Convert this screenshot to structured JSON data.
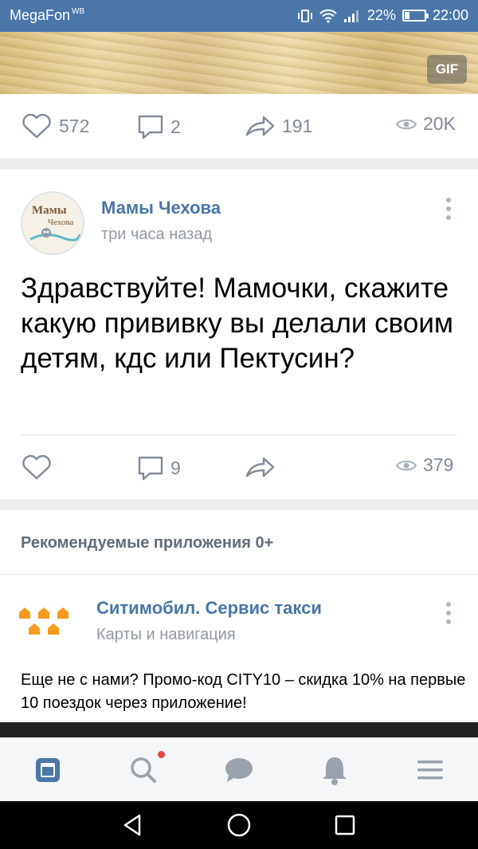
{
  "status_bar": {
    "carrier": "MegaFon",
    "carrier_suffix": "WB",
    "battery": "22%",
    "time": "22:00"
  },
  "gif_post": {
    "badge": "GIF",
    "likes": "572",
    "comments": "2",
    "shares": "191",
    "views": "20K"
  },
  "post": {
    "author": "Мамы Чехова",
    "time": "три часа назад",
    "text": "Здравствуйте! Мамочки, скажите какую прививку вы делали своим детям, кдс или Пектусин?",
    "comments": "9",
    "views": "379",
    "avatar_text_top": "Мамы",
    "avatar_text_bottom": "Чехова"
  },
  "recommended": {
    "title": "Рекомендуемые приложения 0+",
    "app_name": "Ситимобил. Сервис такси",
    "app_category": "Карты и навигация",
    "app_description": "Еще не с нами? Промо-код CITY10 – скидка 10% на первые 10 поездок через приложение!"
  },
  "colors": {
    "accent": "#4a76a8",
    "muted": "#828a99",
    "logo_orange": "#f79a1e",
    "notification": "#e64646"
  },
  "tabbar": {
    "icons": [
      "news-icon",
      "search-icon",
      "messages-icon",
      "notifications-icon",
      "menu-icon"
    ]
  },
  "navbar": {
    "icons": [
      "back-icon",
      "home-icon",
      "recents-icon"
    ]
  }
}
